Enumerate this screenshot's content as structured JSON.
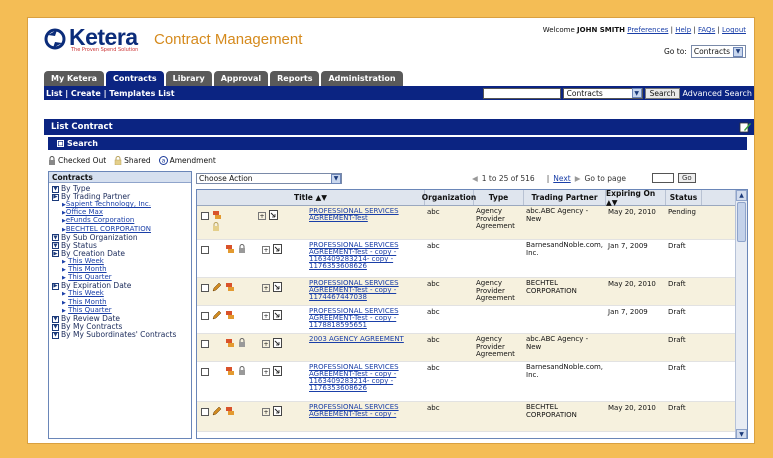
{
  "header": {
    "logo_text": "Ketera",
    "logo_tagline": "The Proven Spend Solution",
    "app_title": "Contract Management",
    "welcome_prefix": "Welcome",
    "user_name": "JOHN SMITH",
    "links": [
      "Preferences",
      "Help",
      "FAQs",
      "Logout"
    ],
    "goto_label": "Go to:",
    "goto_value": "Contracts"
  },
  "tabs": [
    {
      "label": "My Ketera",
      "active": false
    },
    {
      "label": "Contracts",
      "active": true
    },
    {
      "label": "Library",
      "active": false
    },
    {
      "label": "Approval",
      "active": false
    },
    {
      "label": "Reports",
      "active": false
    },
    {
      "label": "Administration",
      "active": false
    }
  ],
  "navbar": {
    "links": "List | Create | Templates List",
    "search_scope": "Contracts",
    "search_button": "Search",
    "advanced_search": "Advanced Search"
  },
  "list": {
    "header": "List Contract",
    "search_bar": "Search",
    "legend": {
      "checked_out": "Checked Out",
      "shared": "Shared",
      "amendment": "Amendment"
    },
    "action_select": "Choose Action",
    "pager": {
      "range": "1 to 25 of 516",
      "next": "Next",
      "go_to_page": "Go to page",
      "go": "Go"
    }
  },
  "left_panel": {
    "title": "Contracts",
    "tree": [
      {
        "label": "By Type",
        "children": []
      },
      {
        "label": "By Trading Partner",
        "children": [
          "Sapient Technology, Inc.",
          "Office Max",
          "eFunds Corporation",
          "BECHTEL CORPORATION"
        ]
      },
      {
        "label": "By Sub Organization",
        "children": []
      },
      {
        "label": "By Status",
        "children": []
      },
      {
        "label": "By Creation Date",
        "children": [
          "This Week",
          "This Month",
          "This Quarter"
        ]
      },
      {
        "label": "By Expiration Date",
        "children": [
          "This Week",
          "This Month",
          "This Quarter"
        ]
      },
      {
        "label": "By Review Date",
        "children": []
      },
      {
        "label": "By My Contracts",
        "children": []
      },
      {
        "label": "By My Subordinates' Contracts",
        "children": []
      }
    ]
  },
  "table": {
    "columns": [
      "Title ▲▼",
      "Organization",
      "Type",
      "Trading Partner",
      "Expiring On ▲▼",
      "Status"
    ],
    "rows": [
      {
        "title": "PROFESSIONAL SERVICES AGREEMENT-Test",
        "org": "abc",
        "type": "Agency Provider Agreement",
        "partner": "abc.ABC Agency - New",
        "expiring": "May 20, 2010",
        "status": "Pending",
        "pencil": false,
        "lock": false,
        "shared": true
      },
      {
        "title": "PROFESSIONAL SERVICES AGREEMENT-Test - copy - 1163409283214- copy - 1176353608626",
        "org": "abc",
        "type": "",
        "partner": "BarnesandNoble.com, Inc.",
        "expiring": "Jan 7, 2009",
        "status": "Draft",
        "pencil": false,
        "lock": true,
        "shared": false
      },
      {
        "title": "PROFESSIONAL SERVICES AGREEMENT-Test - copy - 1174467447038",
        "org": "abc",
        "type": "Agency Provider Agreement",
        "partner": "BECHTEL CORPORATION",
        "expiring": "May 20, 2010",
        "status": "Draft",
        "pencil": true,
        "lock": false,
        "shared": false
      },
      {
        "title": "PROFESSIONAL SERVICES AGREEMENT-Test - copy - 1178818595651",
        "org": "abc",
        "type": "",
        "partner": "",
        "expiring": "Jan 7, 2009",
        "status": "Draft",
        "pencil": true,
        "lock": false,
        "shared": false
      },
      {
        "title": "2003 AGENCY AGREEMENT",
        "org": "abc",
        "type": "Agency Provider Agreement",
        "partner": "abc.ABC Agency - New",
        "expiring": "",
        "status": "Draft",
        "pencil": false,
        "lock": true,
        "shared": false
      },
      {
        "title": "PROFESSIONAL SERVICES AGREEMENT-Test - copy - 1163409283214- copy - 1176353608626",
        "org": "abc",
        "type": "",
        "partner": "BarnesandNoble.com, Inc.",
        "expiring": "",
        "status": "Draft",
        "pencil": false,
        "lock": true,
        "shared": false
      },
      {
        "title": "PROFESSIONAL SERVICES AGREEMENT-Test - copy -",
        "org": "abc",
        "type": "",
        "partner": "BECHTEL CORPORATION",
        "expiring": "May 20, 2010",
        "status": "Draft",
        "pencil": true,
        "lock": false,
        "shared": false
      }
    ]
  }
}
